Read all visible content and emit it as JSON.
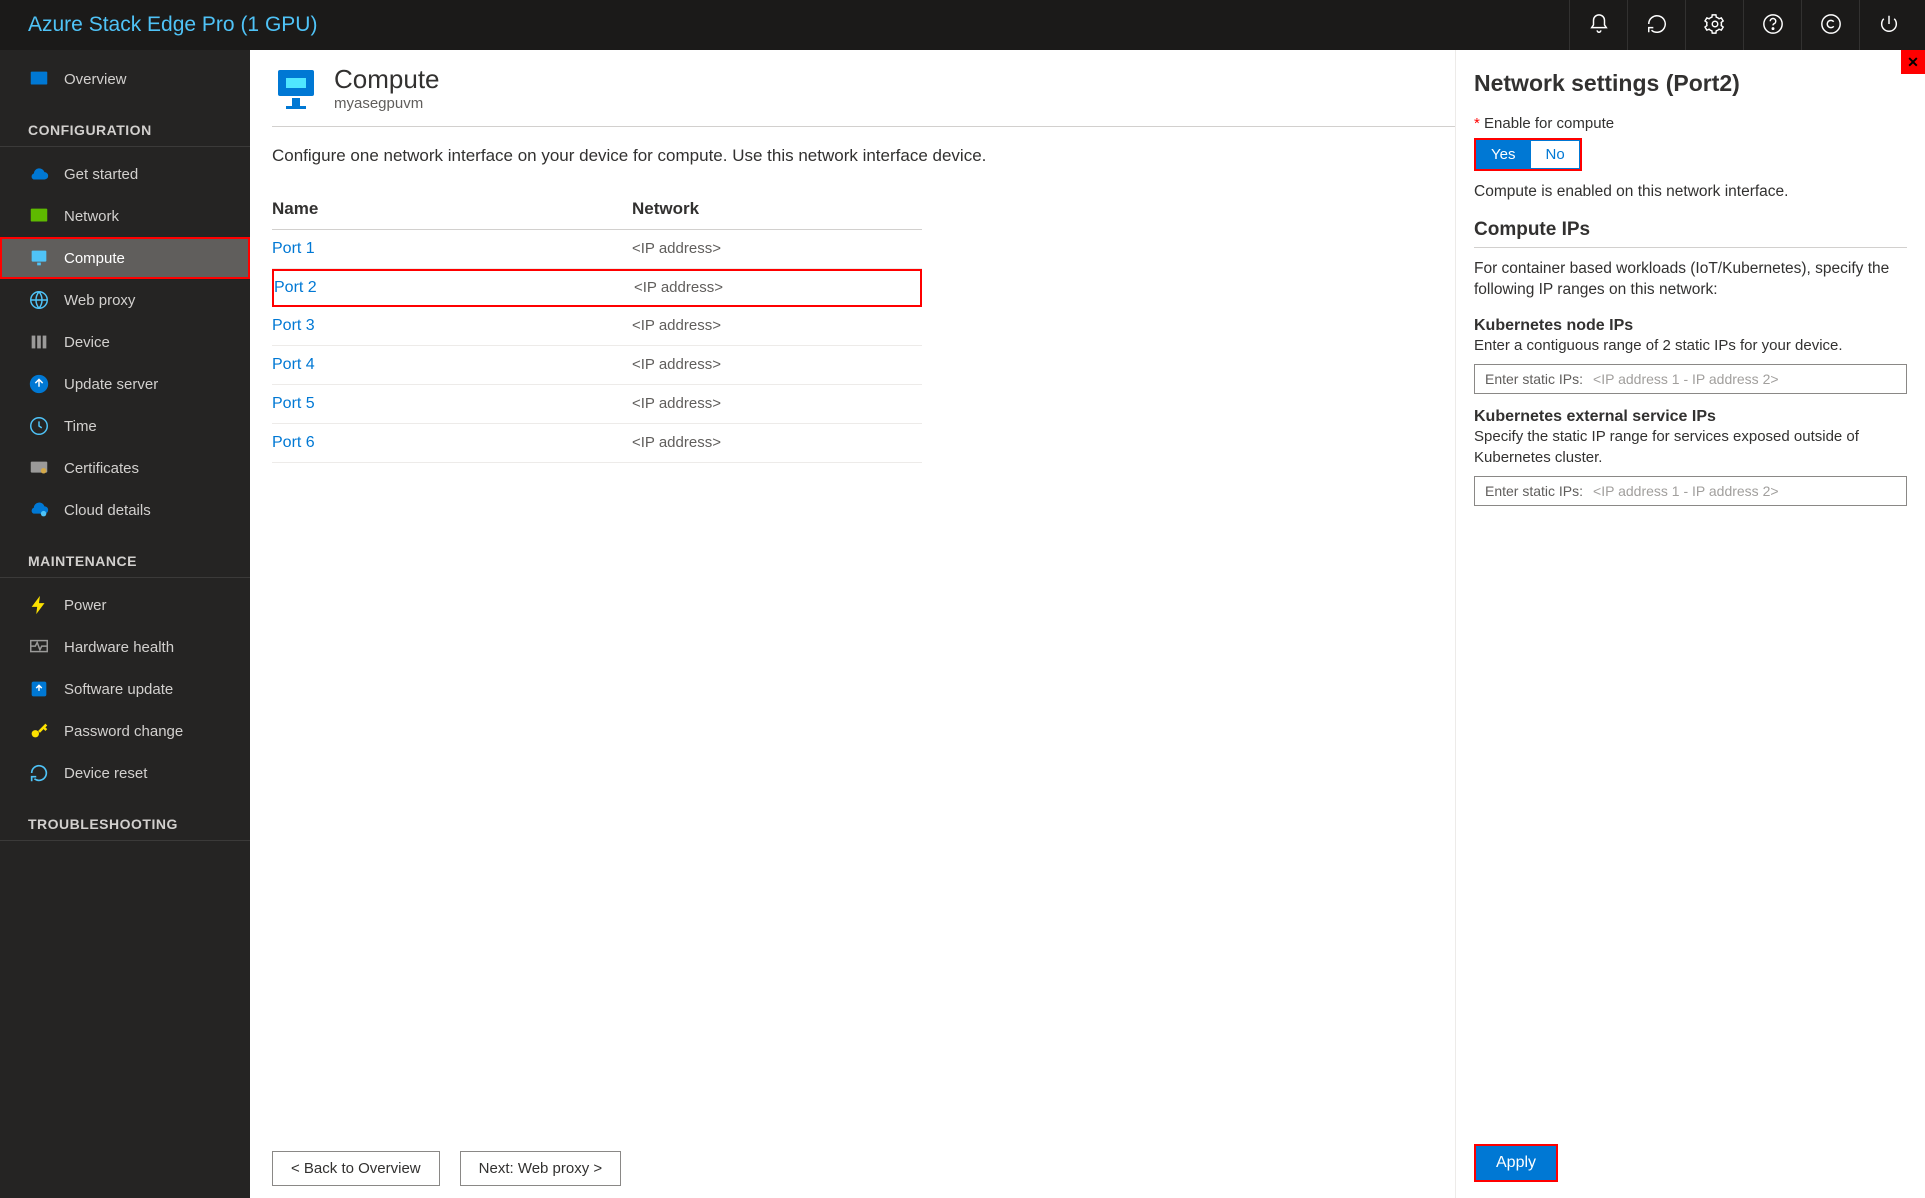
{
  "product_title": "Azure Stack Edge Pro (1 GPU)",
  "sidebar": {
    "overview": "Overview",
    "section_config": "CONFIGURATION",
    "get_started": "Get started",
    "network": "Network",
    "compute": "Compute",
    "web_proxy": "Web proxy",
    "device": "Device",
    "update_server": "Update server",
    "time": "Time",
    "certificates": "Certificates",
    "cloud_details": "Cloud details",
    "section_maint": "MAINTENANCE",
    "power": "Power",
    "hardware_health": "Hardware health",
    "software_update": "Software update",
    "password_change": "Password change",
    "device_reset": "Device reset",
    "section_trouble": "TROUBLESHOOTING"
  },
  "content": {
    "title": "Compute",
    "subtitle": "myasegpuvm",
    "description": "Configure one network interface on your device for compute. Use this network interface device.",
    "table": {
      "col_name": "Name",
      "col_network": "Network",
      "rows": [
        {
          "name": "Port 1",
          "network": "<IP address>"
        },
        {
          "name": "Port 2",
          "network": "<IP address>"
        },
        {
          "name": "Port 3",
          "network": "<IP address>"
        },
        {
          "name": "Port 4",
          "network": "<IP address>"
        },
        {
          "name": "Port 5",
          "network": "<IP address>"
        },
        {
          "name": "Port 6",
          "network": "<IP address>"
        }
      ]
    },
    "footer_back": "<  Back to Overview",
    "footer_next": "Next: Web proxy  >"
  },
  "panel": {
    "title": "Network settings (Port2)",
    "enable_label": "Enable for compute",
    "toggle_yes": "Yes",
    "toggle_no": "No",
    "enabled_text": "Compute is enabled on this network interface.",
    "compute_ips_title": "Compute IPs",
    "compute_ips_desc": "For container based workloads (IoT/Kubernetes), specify the following IP ranges on this network:",
    "k8s_node_title": "Kubernetes node IPs",
    "k8s_node_desc": "Enter a contiguous range of 2 static IPs for your device.",
    "input_prefix": "Enter static IPs:",
    "input_hint": "<IP address 1 - IP address 2>",
    "k8s_ext_title": "Kubernetes external service IPs",
    "k8s_ext_desc": "Specify the static IP range for services exposed outside of Kubernetes cluster.",
    "apply": "Apply"
  }
}
